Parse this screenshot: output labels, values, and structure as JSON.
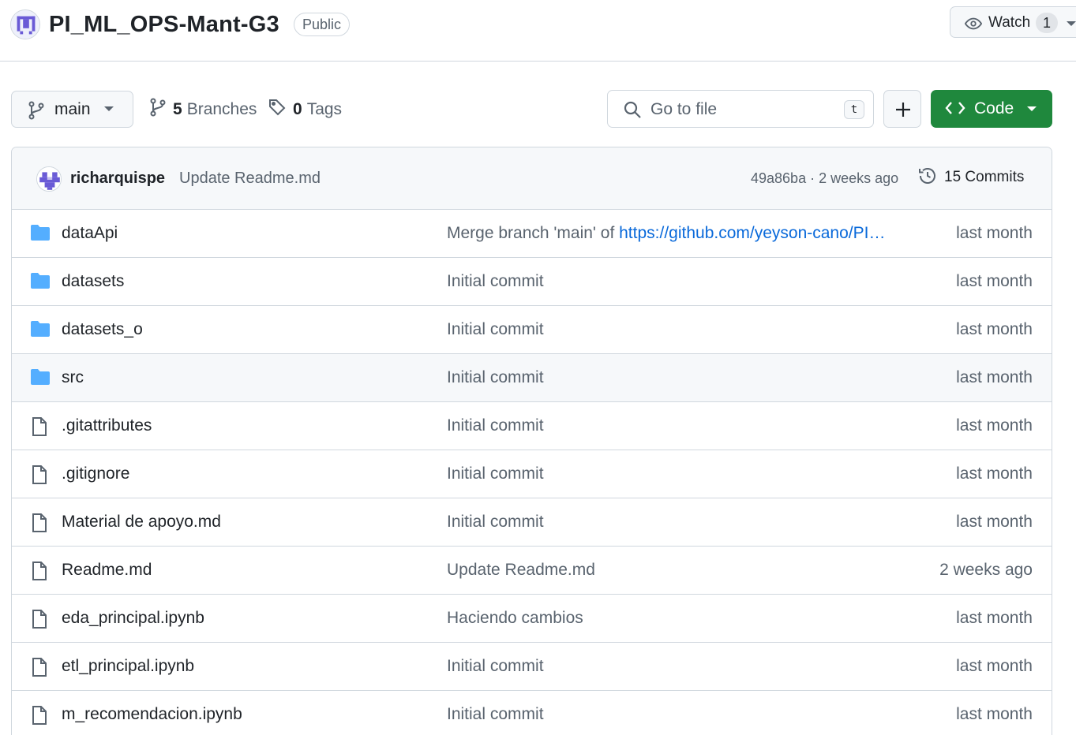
{
  "repo": {
    "name": "PI_ML_OPS-Mant-G3",
    "visibility": "Public",
    "watch_label": "Watch",
    "watch_count": "1"
  },
  "toolbar": {
    "branch": "main",
    "branches_count": "5",
    "branches_label": "Branches",
    "tags_count": "0",
    "tags_label": "Tags",
    "search_placeholder": "Go to file",
    "search_shortcut": "t",
    "code_label": "Code"
  },
  "latest_commit": {
    "author": "richarquispe",
    "message": "Update Readme.md",
    "meta": "49a86ba · 2 weeks ago",
    "commits_label": "15 Commits"
  },
  "colors": {
    "accent_green": "#1f883d",
    "folder_blue": "#54aeff",
    "link_blue": "#0969da"
  },
  "files": [
    {
      "type": "folder-icon",
      "name": "dataApi",
      "message_prefix": "Merge branch 'main' of ",
      "message_link": "https://github.com/yeyson-cano/PI…",
      "time": "last month"
    },
    {
      "type": "folder-icon",
      "name": "datasets",
      "message_prefix": "Initial commit",
      "message_link": "",
      "time": "last month"
    },
    {
      "type": "folder-icon",
      "name": "datasets_o",
      "message_prefix": "Initial commit",
      "message_link": "",
      "time": "last month"
    },
    {
      "type": "folder-icon",
      "name": "src",
      "message_prefix": "Initial commit",
      "message_link": "",
      "time": "last month"
    },
    {
      "type": "file-icon",
      "name": ".gitattributes",
      "message_prefix": "Initial commit",
      "message_link": "",
      "time": "last month"
    },
    {
      "type": "file-icon",
      "name": ".gitignore",
      "message_prefix": "Initial commit",
      "message_link": "",
      "time": "last month"
    },
    {
      "type": "file-icon",
      "name": "Material de apoyo.md",
      "message_prefix": "Initial commit",
      "message_link": "",
      "time": "last month"
    },
    {
      "type": "file-icon",
      "name": "Readme.md",
      "message_prefix": "Update Readme.md",
      "message_link": "",
      "time": "2 weeks ago"
    },
    {
      "type": "file-icon",
      "name": "eda_principal.ipynb",
      "message_prefix": "Haciendo cambios",
      "message_link": "",
      "time": "last month"
    },
    {
      "type": "file-icon",
      "name": "etl_principal.ipynb",
      "message_prefix": "Initial commit",
      "message_link": "",
      "time": "last month"
    },
    {
      "type": "file-icon",
      "name": "m_recomendacion.ipynb",
      "message_prefix": "Initial commit",
      "message_link": "",
      "time": "last month"
    }
  ]
}
